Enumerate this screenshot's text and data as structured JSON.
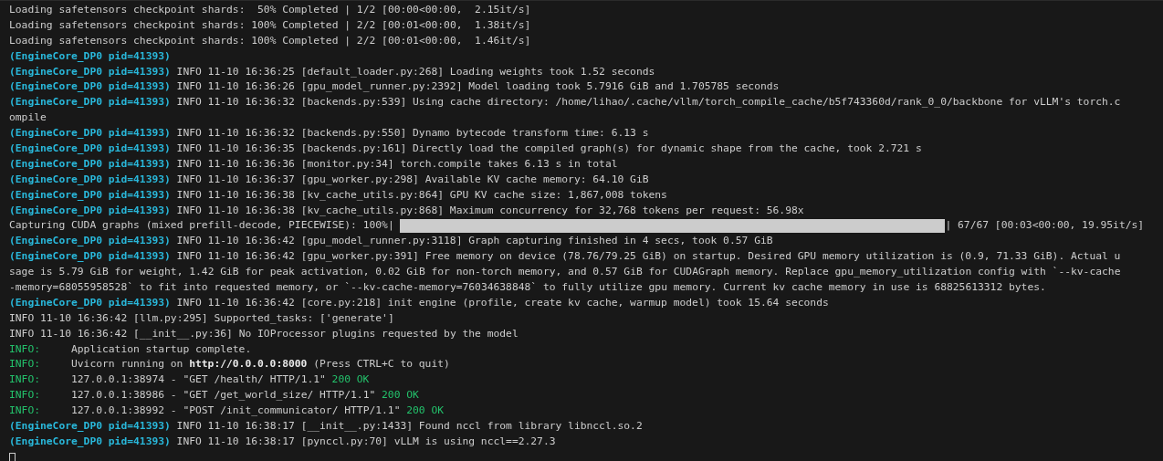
{
  "terminal": {
    "lines": [
      {
        "kind": "text",
        "segments": [
          {
            "kind": "plain",
            "text": "Loading safetensors checkpoint shards:  50% Completed | 1/2 [00:00<00:00,  2.15it/s]"
          }
        ]
      },
      {
        "kind": "text",
        "segments": [
          {
            "kind": "plain",
            "text": "Loading safetensors checkpoint shards: 100% Completed | 2/2 [00:01<00:00,  1.38it/s]"
          }
        ]
      },
      {
        "kind": "text",
        "segments": [
          {
            "kind": "plain",
            "text": "Loading safetensors checkpoint shards: 100% Completed | 2/2 [00:01<00:00,  1.46it/s]"
          }
        ]
      },
      {
        "kind": "text",
        "segments": [
          {
            "kind": "process",
            "text": "(EngineCore_DP0 pid=41393)"
          }
        ]
      },
      {
        "kind": "text",
        "segments": [
          {
            "kind": "process",
            "text": "(EngineCore_DP0 pid=41393)"
          },
          {
            "kind": "plain",
            "text": "INFO 11-10 16:36:25 [default_loader.py:268] Loading weights took 1.52 seconds"
          }
        ]
      },
      {
        "kind": "text",
        "segments": [
          {
            "kind": "process",
            "text": "(EngineCore_DP0 pid=41393)"
          },
          {
            "kind": "plain",
            "text": "INFO 11-10 16:36:26 [gpu_model_runner.py:2392] Model loading took 5.7916 GiB and 1.705785 seconds"
          }
        ]
      },
      {
        "kind": "text",
        "segments": [
          {
            "kind": "process",
            "text": "(EngineCore_DP0 pid=41393)"
          },
          {
            "kind": "plain",
            "text": "INFO 11-10 16:36:32 [backends.py:539] Using cache directory: /home/lihao/.cache/vllm/torch_compile_cache/b5f743360d/rank_0_0/backbone for vLLM's torch.c"
          }
        ]
      },
      {
        "kind": "text",
        "segments": [
          {
            "kind": "plain",
            "text": "ompile"
          }
        ]
      },
      {
        "kind": "text",
        "segments": [
          {
            "kind": "process",
            "text": "(EngineCore_DP0 pid=41393)"
          },
          {
            "kind": "plain",
            "text": "INFO 11-10 16:36:32 [backends.py:550] Dynamo bytecode transform time: 6.13 s"
          }
        ]
      },
      {
        "kind": "text",
        "segments": [
          {
            "kind": "process",
            "text": "(EngineCore_DP0 pid=41393)"
          },
          {
            "kind": "plain",
            "text": "INFO 11-10 16:36:35 [backends.py:161] Directly load the compiled graph(s) for dynamic shape from the cache, took 2.721 s"
          }
        ]
      },
      {
        "kind": "text",
        "segments": [
          {
            "kind": "process",
            "text": "(EngineCore_DP0 pid=41393)"
          },
          {
            "kind": "plain",
            "text": "INFO 11-10 16:36:36 [monitor.py:34] torch.compile takes 6.13 s in total"
          }
        ]
      },
      {
        "kind": "text",
        "segments": [
          {
            "kind": "process",
            "text": "(EngineCore_DP0 pid=41393)"
          },
          {
            "kind": "plain",
            "text": "INFO 11-10 16:36:37 [gpu_worker.py:298] Available KV cache memory: 64.10 GiB"
          }
        ]
      },
      {
        "kind": "text",
        "segments": [
          {
            "kind": "process",
            "text": "(EngineCore_DP0 pid=41393)"
          },
          {
            "kind": "plain",
            "text": "INFO 11-10 16:36:38 [kv_cache_utils.py:864] GPU KV cache size: 1,867,008 tokens"
          }
        ]
      },
      {
        "kind": "text",
        "segments": [
          {
            "kind": "process",
            "text": "(EngineCore_DP0 pid=41393)"
          },
          {
            "kind": "plain",
            "text": "INFO 11-10 16:36:38 [kv_cache_utils.py:868] Maximum concurrency for 32,768 tokens per request: 56.98x"
          }
        ]
      },
      {
        "kind": "progress",
        "label": "Capturing CUDA graphs (mixed prefill-decode, PIECEWISE): 100%|",
        "level": 1,
        "stats": "| 67/67 [00:03<00:00, 19.95it/s]"
      },
      {
        "kind": "text",
        "segments": [
          {
            "kind": "process",
            "text": "(EngineCore_DP0 pid=41393)"
          },
          {
            "kind": "plain",
            "text": "INFO 11-10 16:36:42 [gpu_model_runner.py:3118] Graph capturing finished in 4 secs, took 0.57 GiB"
          }
        ]
      },
      {
        "kind": "text",
        "segments": [
          {
            "kind": "process",
            "text": "(EngineCore_DP0 pid=41393)"
          },
          {
            "kind": "plain",
            "text": "INFO 11-10 16:36:42 [gpu_worker.py:391] Free memory on device (78.76/79.25 GiB) on startup. Desired GPU memory utilization is (0.9, 71.33 GiB). Actual u"
          }
        ]
      },
      {
        "kind": "text",
        "segments": [
          {
            "kind": "plain",
            "text": "sage is 5.79 GiB for weight, 1.42 GiB for peak activation, 0.02 GiB for non-torch memory, and 0.57 GiB for CUDAGraph memory. Replace gpu_memory_utilization config with `--kv-cache"
          }
        ]
      },
      {
        "kind": "text",
        "segments": [
          {
            "kind": "plain",
            "text": "-memory=68055958528` to fit into requested memory, or `--kv-cache-memory=76034638848` to fully utilize gpu memory. Current kv cache memory in use is 68825613312 bytes."
          }
        ]
      },
      {
        "kind": "text",
        "segments": [
          {
            "kind": "process",
            "text": "(EngineCore_DP0 pid=41393)"
          },
          {
            "kind": "plain",
            "text": "INFO 11-10 16:36:42 [core.py:218] init engine (profile, create kv cache, warmup model) took 15.64 seconds"
          }
        ]
      },
      {
        "kind": "text",
        "segments": [
          {
            "kind": "plain",
            "text": "INFO 11-10 16:36:42 [llm.py:295] Supported_tasks: ['generate']"
          }
        ]
      },
      {
        "kind": "text",
        "segments": [
          {
            "kind": "plain",
            "text": "INFO 11-10 16:36:42 [__init__.py:36] No IOProcessor plugins requested by the model"
          }
        ]
      },
      {
        "kind": "text",
        "segments": [
          {
            "kind": "level",
            "text": "INFO:"
          },
          {
            "kind": "plain",
            "text": "    Application startup complete."
          }
        ]
      },
      {
        "kind": "text",
        "segments": [
          {
            "kind": "level",
            "text": "INFO:"
          },
          {
            "kind": "plain",
            "text": "    Uvicorn running on"
          },
          {
            "kind": "url",
            "text": "http://0.0.0.0:8000"
          },
          {
            "kind": "plain",
            "text": "(Press CTRL+C to quit)"
          }
        ]
      },
      {
        "kind": "text",
        "segments": [
          {
            "kind": "level",
            "text": "INFO:"
          },
          {
            "kind": "plain",
            "text": "    127.0.0.1:38974 - \"GET /health/ HTTP/1.1\""
          },
          {
            "kind": "status",
            "text": "200 OK"
          }
        ]
      },
      {
        "kind": "text",
        "segments": [
          {
            "kind": "level",
            "text": "INFO:"
          },
          {
            "kind": "plain",
            "text": "    127.0.0.1:38986 - \"GET /get_world_size/ HTTP/1.1\""
          },
          {
            "kind": "status",
            "text": "200 OK"
          }
        ]
      },
      {
        "kind": "text",
        "segments": [
          {
            "kind": "level",
            "text": "INFO:"
          },
          {
            "kind": "plain",
            "text": "    127.0.0.1:38992 - \"POST /init_communicator/ HTTP/1.1\""
          },
          {
            "kind": "status",
            "text": "200 OK"
          }
        ]
      },
      {
        "kind": "text",
        "segments": [
          {
            "kind": "process",
            "text": "(EngineCore_DP0 pid=41393)"
          },
          {
            "kind": "plain",
            "text": "INFO 11-10 16:38:17 [__init__.py:1433] Found nccl from library libnccl.so.2"
          }
        ]
      },
      {
        "kind": "text",
        "segments": [
          {
            "kind": "process",
            "text": "(EngineCore_DP0 pid=41393)"
          },
          {
            "kind": "plain",
            "text": "INFO 11-10 16:38:17 [pynccl.py:70] vLLM is using nccl==2.27.3"
          }
        ]
      },
      {
        "kind": "cursor"
      }
    ]
  }
}
